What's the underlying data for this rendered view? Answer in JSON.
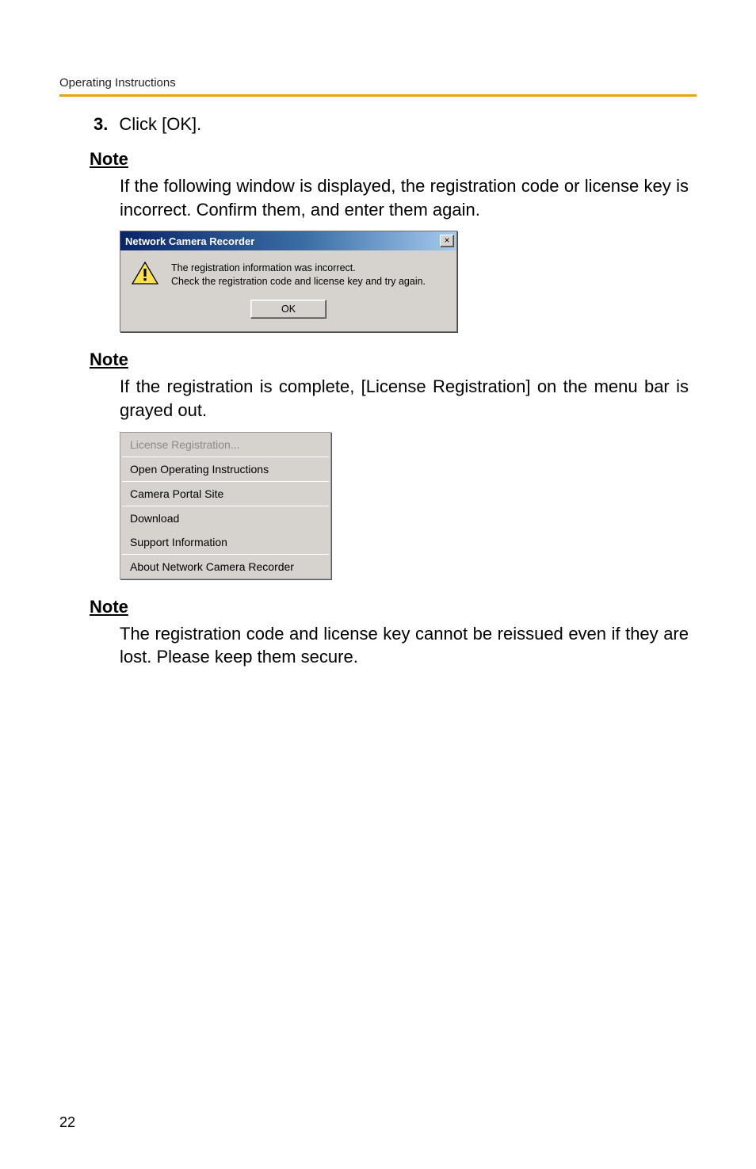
{
  "header": {
    "label": "Operating Instructions"
  },
  "step": {
    "number": "3.",
    "text": "Click [OK]."
  },
  "notes": {
    "heading": "Note",
    "first": "If the following window is displayed, the registration code or license key is incorrect. Confirm them, and enter them again.",
    "second": "If the registration is complete, [License Registration] on the menu bar is grayed out.",
    "third": "The registration code and license key cannot be reissued even if they are lost. Please keep them secure."
  },
  "dialog": {
    "title": "Network Camera Recorder",
    "close_label": "×",
    "message_line1": "The registration information was incorrect.",
    "message_line2": "Check the registration code and license key and try again.",
    "ok_label": "OK"
  },
  "menu": {
    "items": [
      {
        "label": "License Registration...",
        "disabled": true
      },
      {
        "label": "Open Operating Instructions",
        "disabled": false
      },
      {
        "label": "Camera Portal Site",
        "disabled": false
      },
      {
        "label": "Download",
        "disabled": false
      },
      {
        "label": "Support Information",
        "disabled": false
      },
      {
        "label": "About Network Camera Recorder",
        "disabled": false
      }
    ]
  },
  "page_number": "22"
}
